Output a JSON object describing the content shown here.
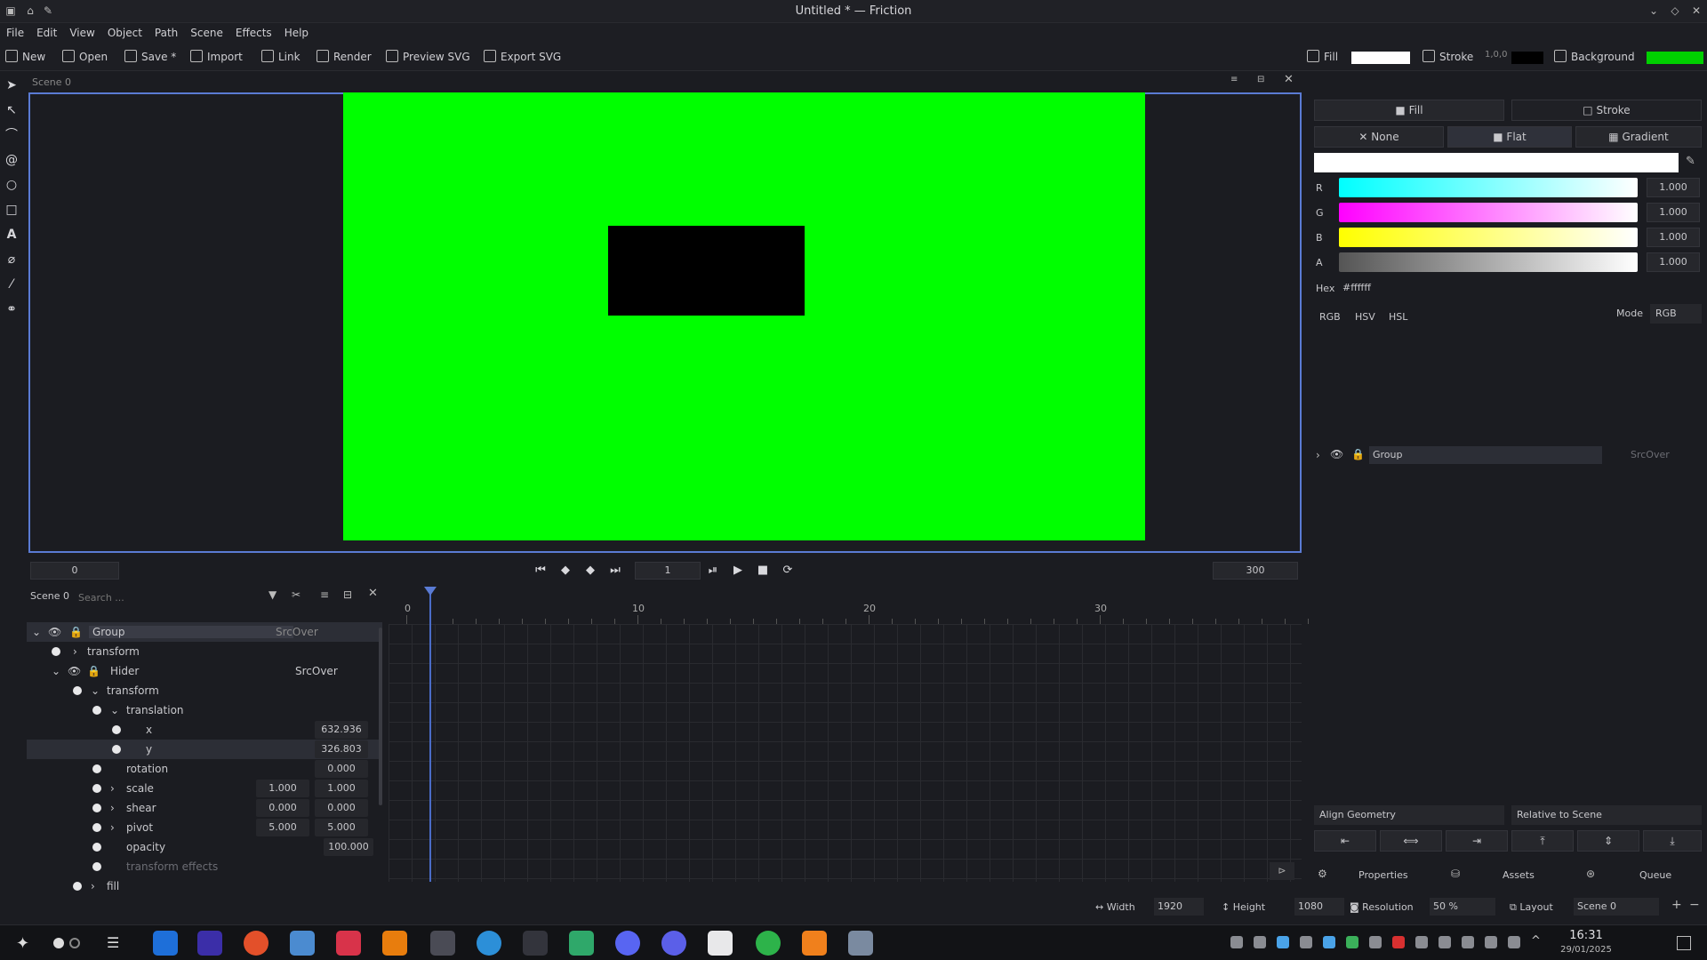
{
  "window": {
    "title": "Untitled * — Friction"
  },
  "menu": [
    "File",
    "Edit",
    "View",
    "Object",
    "Path",
    "Scene",
    "Effects",
    "Help"
  ],
  "toolbar": {
    "new": "New",
    "open": "Open",
    "save": "Save *",
    "import": "Import",
    "link": "Link",
    "render": "Render",
    "preview_svg": "Preview SVG",
    "export_svg": "Export SVG",
    "fill": "Fill",
    "stroke": "Stroke",
    "stroke_value": "1,0,0",
    "background": "Background"
  },
  "viewport": {
    "scene_label": "Scene 0"
  },
  "playback": {
    "start_frame": "0",
    "current_frame": "1",
    "end_frame": "300"
  },
  "layers_panel": {
    "scene_label": "Scene 0",
    "search_placeholder": "Search ..."
  },
  "tree": {
    "group": "Group",
    "group_blend": "SrcOver",
    "transform": "transform",
    "layer": "Hider",
    "layer_blend": "SrcOver",
    "layer_transform": "transform",
    "translation": "translation",
    "x_label": "x",
    "x_val": "632.936",
    "y_label": "y",
    "y_val": "326.803",
    "rotation": "rotation",
    "rotation_val": "0.000",
    "scale": "scale",
    "scale_x": "1.000",
    "scale_y": "1.000",
    "shear": "shear",
    "shear_x": "0.000",
    "shear_y": "0.000",
    "pivot": "pivot",
    "pivot_x": "5.000",
    "pivot_y": "5.000",
    "opacity": "opacity",
    "opacity_val": "100.000",
    "transform_effects": "transform effects",
    "fill": "fill"
  },
  "timeline": {
    "ticks": [
      "0",
      "10",
      "20",
      "30"
    ]
  },
  "color_panel": {
    "tab_fill": "Fill",
    "tab_stroke": "Stroke",
    "mode_none": "None",
    "mode_flat": "Flat",
    "mode_gradient": "Gradient",
    "r_label": "R",
    "g_label": "G",
    "b_label": "B",
    "a_label": "A",
    "r_val": "1.000",
    "g_val": "1.000",
    "b_val": "1.000",
    "a_val": "1.000",
    "hex_label": "Hex",
    "hex_val": "#ffffff",
    "tab_rgb": "RGB",
    "tab_hsv": "HSV",
    "tab_hsl": "HSL",
    "mode_label": "Mode",
    "mode_val": "RGB"
  },
  "object_list": {
    "group": "Group",
    "blend": "SrcOver"
  },
  "align": {
    "geometry": "Align Geometry",
    "relative": "Relative to Scene"
  },
  "dock_tabs": {
    "properties": "Properties",
    "assets": "Assets",
    "queue": "Queue"
  },
  "statusbar": {
    "width_label": "Width",
    "width_val": "1920",
    "height_label": "Height",
    "height_val": "1080",
    "resolution_label": "Resolution",
    "resolution_val": "50 %",
    "layout_label": "Layout",
    "layout_val": "Scene 0"
  },
  "clock": {
    "time": "16:31",
    "date": "29/01/2025"
  },
  "colors": {
    "accent": "#5a7bd4",
    "canvas": "#00ff00",
    "object": "#000000"
  }
}
